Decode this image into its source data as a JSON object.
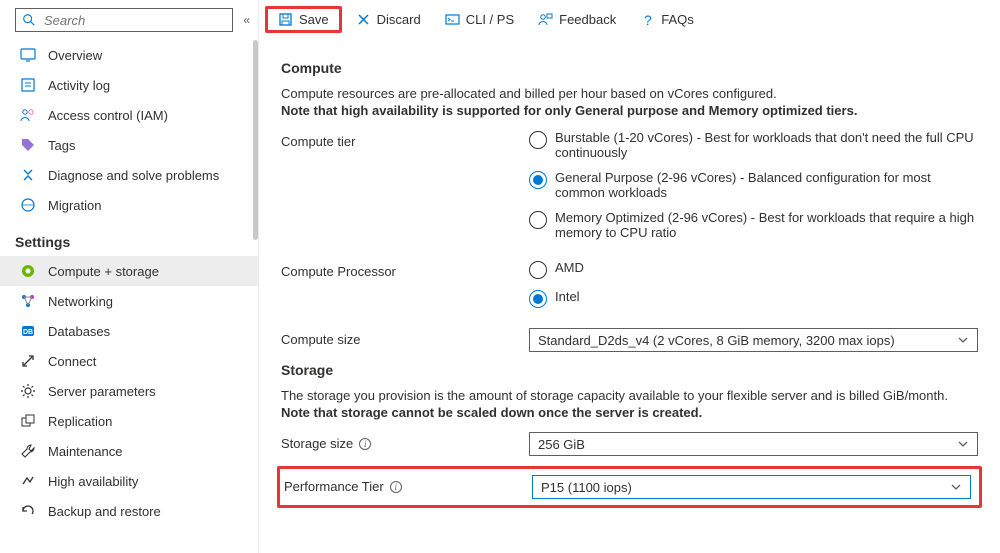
{
  "search": {
    "placeholder": "Search"
  },
  "sidebar": {
    "items": [
      {
        "label": "Overview"
      },
      {
        "label": "Activity log"
      },
      {
        "label": "Access control (IAM)"
      },
      {
        "label": "Tags"
      },
      {
        "label": "Diagnose and solve problems"
      },
      {
        "label": "Migration"
      }
    ],
    "settings_header": "Settings",
    "settings_items": [
      {
        "label": "Compute + storage"
      },
      {
        "label": "Networking"
      },
      {
        "label": "Databases"
      },
      {
        "label": "Connect"
      },
      {
        "label": "Server parameters"
      },
      {
        "label": "Replication"
      },
      {
        "label": "Maintenance"
      },
      {
        "label": "High availability"
      },
      {
        "label": "Backup and restore"
      }
    ]
  },
  "toolbar": {
    "save": "Save",
    "discard": "Discard",
    "cli": "CLI / PS",
    "feedback": "Feedback",
    "faqs": "FAQs"
  },
  "compute": {
    "heading": "Compute",
    "desc": "Compute resources are pre-allocated and billed per hour based on vCores configured.",
    "note": "Note that high availability is supported for only General purpose and Memory optimized tiers.",
    "tier_label": "Compute tier",
    "tiers": [
      "Burstable (1-20 vCores) - Best for workloads that don't need the full CPU continuously",
      "General Purpose (2-96 vCores) - Balanced configuration for most common workloads",
      "Memory Optimized (2-96 vCores) - Best for workloads that require a high memory to CPU ratio"
    ],
    "processor_label": "Compute Processor",
    "processors": [
      "AMD",
      "Intel"
    ],
    "size_label": "Compute size",
    "size_value": "Standard_D2ds_v4 (2 vCores, 8 GiB memory, 3200 max iops)"
  },
  "storage": {
    "heading": "Storage",
    "desc": "The storage you provision is the amount of storage capacity available to your flexible server and is billed GiB/month.",
    "note": "Note that storage cannot be scaled down once the server is created.",
    "size_label": "Storage size",
    "size_value": "256 GiB",
    "perf_label": "Performance Tier",
    "perf_value": "P15 (1100 iops)"
  }
}
